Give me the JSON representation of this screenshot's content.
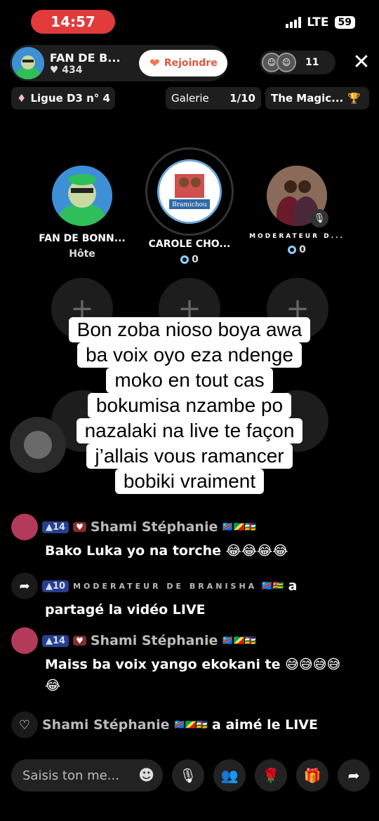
{
  "status": {
    "time": "14:57",
    "network": "LTE",
    "battery": "59"
  },
  "header": {
    "host_name": "FAN DE B...",
    "host_likes": "434",
    "join_label": "Rejoindre",
    "viewer_count": "11",
    "close_symbol": "✕"
  },
  "chips": {
    "league": "Ligue D3 n° 4",
    "gallery_label": "Galerie",
    "gallery_count": "1/10",
    "magic": "The Magic..."
  },
  "stage": {
    "seats": [
      {
        "name": "FAN DE BONN...",
        "sub": "Hôte"
      },
      {
        "name": "CAROLE CHO...",
        "sub": "0",
        "badge": "Bramichou"
      },
      {
        "name": "MODERATEUR D...",
        "sub": "0"
      }
    ],
    "empty_symbol": "+"
  },
  "caption": [
    "Bon zoba nioso boya awa",
    "ba voix oyo eza ndenge",
    "moko en tout cas",
    "bokumisa nzambe po",
    "nazalaki na live te façon",
    "j’allais vous ramancer",
    "bobiki vraiment"
  ],
  "chat": [
    {
      "level": "14",
      "user": "Shami Stéphanie",
      "flags": "🇨🇩🇨🇬🇨🇫",
      "text": "Bako Luka yo na torche 😂😂😂😂"
    },
    {
      "level": "10",
      "user": "MODERATEUR DE BRANISHA",
      "flags": "🇨🇩🇹🇬",
      "action": "a",
      "text": "partagé la vidéo LIVE"
    },
    {
      "level": "14",
      "user": "Shami Stéphanie",
      "flags": "🇨🇩🇨🇬🇨🇫",
      "text": "Maiss ba voix yango ekokani te 😅😅😅😅",
      "text2": "😂"
    },
    {
      "user": "Shami Stéphanie",
      "flags": "🇨🇩🇨🇬🇨🇫",
      "action": "a aimé le LIVE"
    }
  ],
  "bottom": {
    "input_placeholder": "Saisis ton me...",
    "emoji": "☻",
    "mic": "🎙",
    "guests": "👥",
    "rose": "🌹",
    "gift": "🎁",
    "share": "➦"
  }
}
